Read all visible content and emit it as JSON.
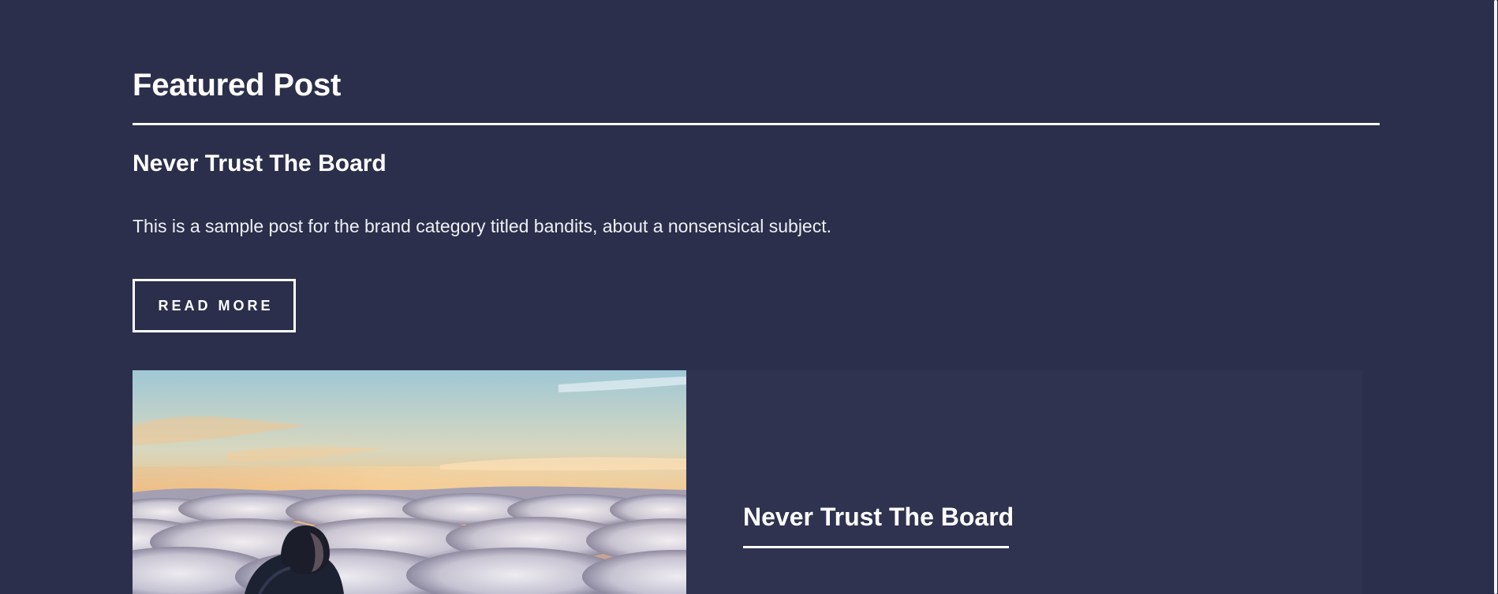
{
  "featured": {
    "section_title": "Featured Post",
    "post_title": "Never Trust The Board",
    "excerpt": "This is a sample post for the brand category titled bandits, about a nonsensical subject.",
    "read_more_label": "READ MORE"
  },
  "card": {
    "image_subject": "person-above-clouds-image",
    "title": "Never Trust The Board"
  },
  "colors": {
    "background": "#2b2f4b",
    "card_background": "#2f3350",
    "text": "#ffffff"
  }
}
